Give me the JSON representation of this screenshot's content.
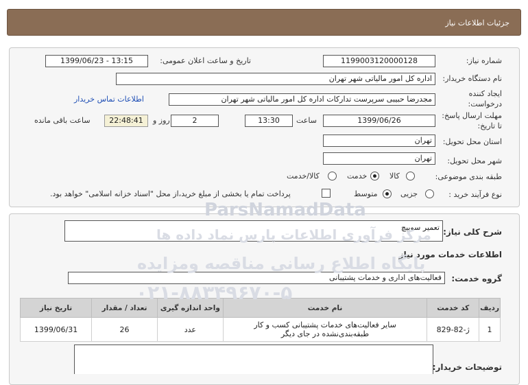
{
  "header": {
    "title": "جزئیات اطلاعات نیاز"
  },
  "form": {
    "need_number": {
      "label": "شماره نیاز:",
      "value": "1199003120000128"
    },
    "announce_datetime": {
      "label": "تاریخ و ساعت اعلان عمومی:",
      "value": "1399/06/23 - 13:15"
    },
    "buyer_org": {
      "label": "نام دستگاه خریدار:",
      "value": "اداره کل امور مالیاتی شهر تهران"
    },
    "requester": {
      "label_line1": "ایجاد کننده",
      "label_line2": "درخواست:",
      "value": "مجدرضا حبیبی سرپرست تدارکات اداره کل امور مالیاتی شهر تهران"
    },
    "contact_link": "اطلاعات تماس خریدار",
    "deadline": {
      "label_line1": "مهلت ارسال پاسخ:",
      "label_line2": "تا تاریخ:",
      "date": "1399/06/26",
      "time_label": "ساعت",
      "time": "13:30",
      "days": "2",
      "days_label": "روز و",
      "remaining": "22:48:41",
      "remaining_label": "ساعت باقی مانده"
    },
    "province": {
      "label": "استان محل تحویل:",
      "value": "تهران"
    },
    "city": {
      "label": "شهر محل تحویل:",
      "value": "تهران"
    },
    "category": {
      "label": "طبقه بندی موضوعی:",
      "options": [
        "کالا",
        "خدمت",
        "کالا/خدمت"
      ],
      "selected": "خدمت"
    },
    "purchase_process": {
      "label": "نوع فرآیند خرید :",
      "options": [
        "جزیی",
        "متوسط"
      ],
      "selected": "متوسط",
      "payment_note": "پرداخت تمام یا بخشی از مبلغ خرید،از محل \"اسناد خزانه اسلامی\" خواهد بود."
    }
  },
  "details": {
    "summary_label": "شرح کلی نیاز:",
    "summary_value": "تعمیر سوییچ",
    "services_title": "اطلاعات خدمات مورد نیاز",
    "service_group_label": "گروه خدمت:",
    "service_group_value": "فعالیت‌های اداری و خدمات پشتیبانی",
    "table": {
      "headers": [
        "ردیف",
        "کد خدمت",
        "نام خدمت",
        "واحد اندازه گیری",
        "تعداد / مقدار",
        "تاریخ نیاز"
      ],
      "rows": [
        {
          "row": "1",
          "code": "ژ-82-829",
          "name_line1": "سایر فعالیت‌های خدمات پشتیبانی کسب و کار",
          "name_line2": "طبقه‌بندی‌نشده در جای دیگر",
          "unit": "عدد",
          "qty": "26",
          "date": "1399/06/31"
        }
      ]
    },
    "buyer_notes_label": "توضیحات خریدار:",
    "buyer_notes_value": ""
  },
  "watermark": {
    "brand": "ParsNamadData",
    "line1": "مرکز فرآوری اطلاعات پارس نماد داده ها",
    "line2": "پایگاه اطلاع رسانی مناقصه ومزایده",
    "phone": "۰۲۱-۸۸۳۴۹۶۷۰-۵"
  }
}
